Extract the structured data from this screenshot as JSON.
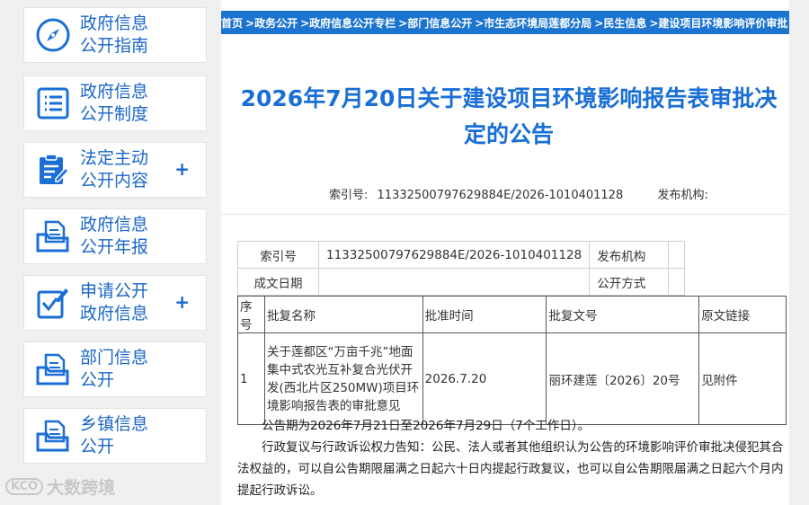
{
  "sidebar": {
    "items": [
      {
        "label": "政府信息\n公开指南",
        "icon": "compass-icon",
        "has_plus": false
      },
      {
        "label": "政府信息\n公开制度",
        "icon": "document-list-icon",
        "has_plus": false
      },
      {
        "label": "法定主动\n公开内容",
        "icon": "clipboard-edit-icon",
        "has_plus": true,
        "plus": "+"
      },
      {
        "label": "政府信息\n公开年报",
        "icon": "folder-document-icon",
        "has_plus": false
      },
      {
        "label": "申请公开\n政府信息",
        "icon": "checkbox-edit-icon",
        "has_plus": true,
        "plus": "+"
      },
      {
        "label": "部门信息\n公开",
        "icon": "folder-document-icon",
        "has_plus": false
      },
      {
        "label": "乡镇信息\n公开",
        "icon": "folder-document-icon",
        "has_plus": false
      }
    ]
  },
  "breadcrumb": [
    "首页",
    ">政务公开",
    ">政府信息公开专栏",
    ">部门信息公开",
    ">市生态环境局莲都分局",
    ">民生信息",
    ">建设项目环境影响评价审批"
  ],
  "article": {
    "title": "2026年7月20日关于建设项目环境影响报告表审批决定的公告",
    "meta": {
      "index_label": "索引号:",
      "index_value": "11332500797629884E/2026-1010401128",
      "publisher_label": "发布机构:"
    }
  },
  "info_table": {
    "index_label": "索引号",
    "index_value": "11332500797629884E/2026-1010401128",
    "publisher_label": "发布机构",
    "date_label": "成文日期",
    "method_label": "公开方式"
  },
  "approval_table": {
    "headers": [
      "序号",
      "批复名称",
      "批准时间",
      "批复文号",
      "原文链接"
    ],
    "rows": [
      [
        "1",
        "关于莲都区“万亩千兆”地面集中式农光互补复合光伏开发(西北片区250MW)项目环境影响报告表的审批意见",
        "2026.7.20",
        "丽环建莲〔2026〕20号",
        "见附件"
      ]
    ]
  },
  "paragraphs": [
    "公告期为2026年7月21日至2026年7月29日（7个工作日）。",
    "行政复议与行政诉讼权力告知：公民、法人或者其他组织认为公告的环境影响评价审批决侵犯其合法权益的，可以自公告期限届满之日起六十日内提起行政复议，也可以自公告期限届满之日起六个月内提起行政诉讼。"
  ],
  "watermark": {
    "logo": "KCO",
    "text": "大数跨境"
  }
}
